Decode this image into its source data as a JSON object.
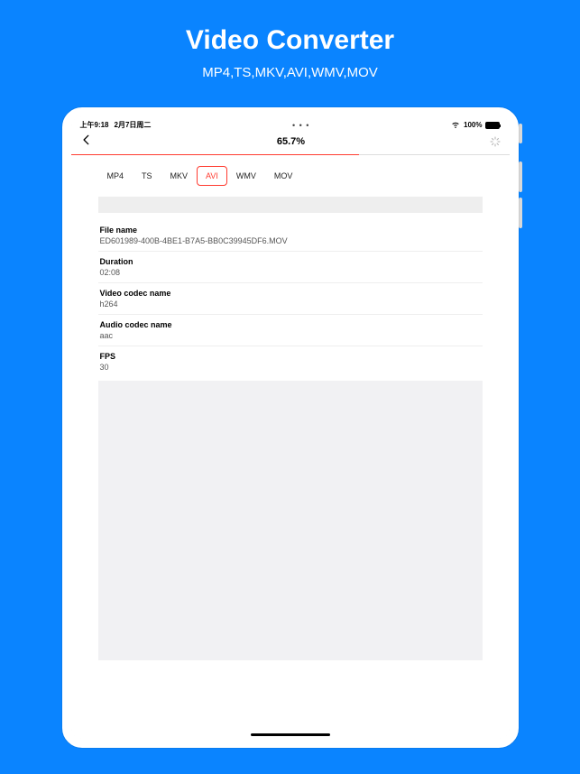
{
  "hero": {
    "title": "Video Converter",
    "subtitle": "MP4,TS,MKV,AVI,WMV,MOV"
  },
  "status": {
    "time": "上午9:18",
    "date": "2月7日周二",
    "battery_text": "100%"
  },
  "nav": {
    "title": "65.7%"
  },
  "progress": {
    "percent": 65.7
  },
  "tabs": {
    "items": [
      {
        "label": "MP4"
      },
      {
        "label": "TS"
      },
      {
        "label": "MKV"
      },
      {
        "label": "AVI"
      },
      {
        "label": "WMV"
      },
      {
        "label": "MOV"
      }
    ],
    "selected_index": 3
  },
  "info": {
    "rows": [
      {
        "label": "File name",
        "value": "ED601989-400B-4BE1-B7A5-BB0C39945DF6.MOV"
      },
      {
        "label": "Duration",
        "value": "02:08"
      },
      {
        "label": "Video codec name",
        "value": "h264"
      },
      {
        "label": "Audio codec name",
        "value": "aac"
      },
      {
        "label": "FPS",
        "value": "30"
      }
    ]
  },
  "colors": {
    "accent": "#ff3b30",
    "bg": "#0a84ff"
  }
}
